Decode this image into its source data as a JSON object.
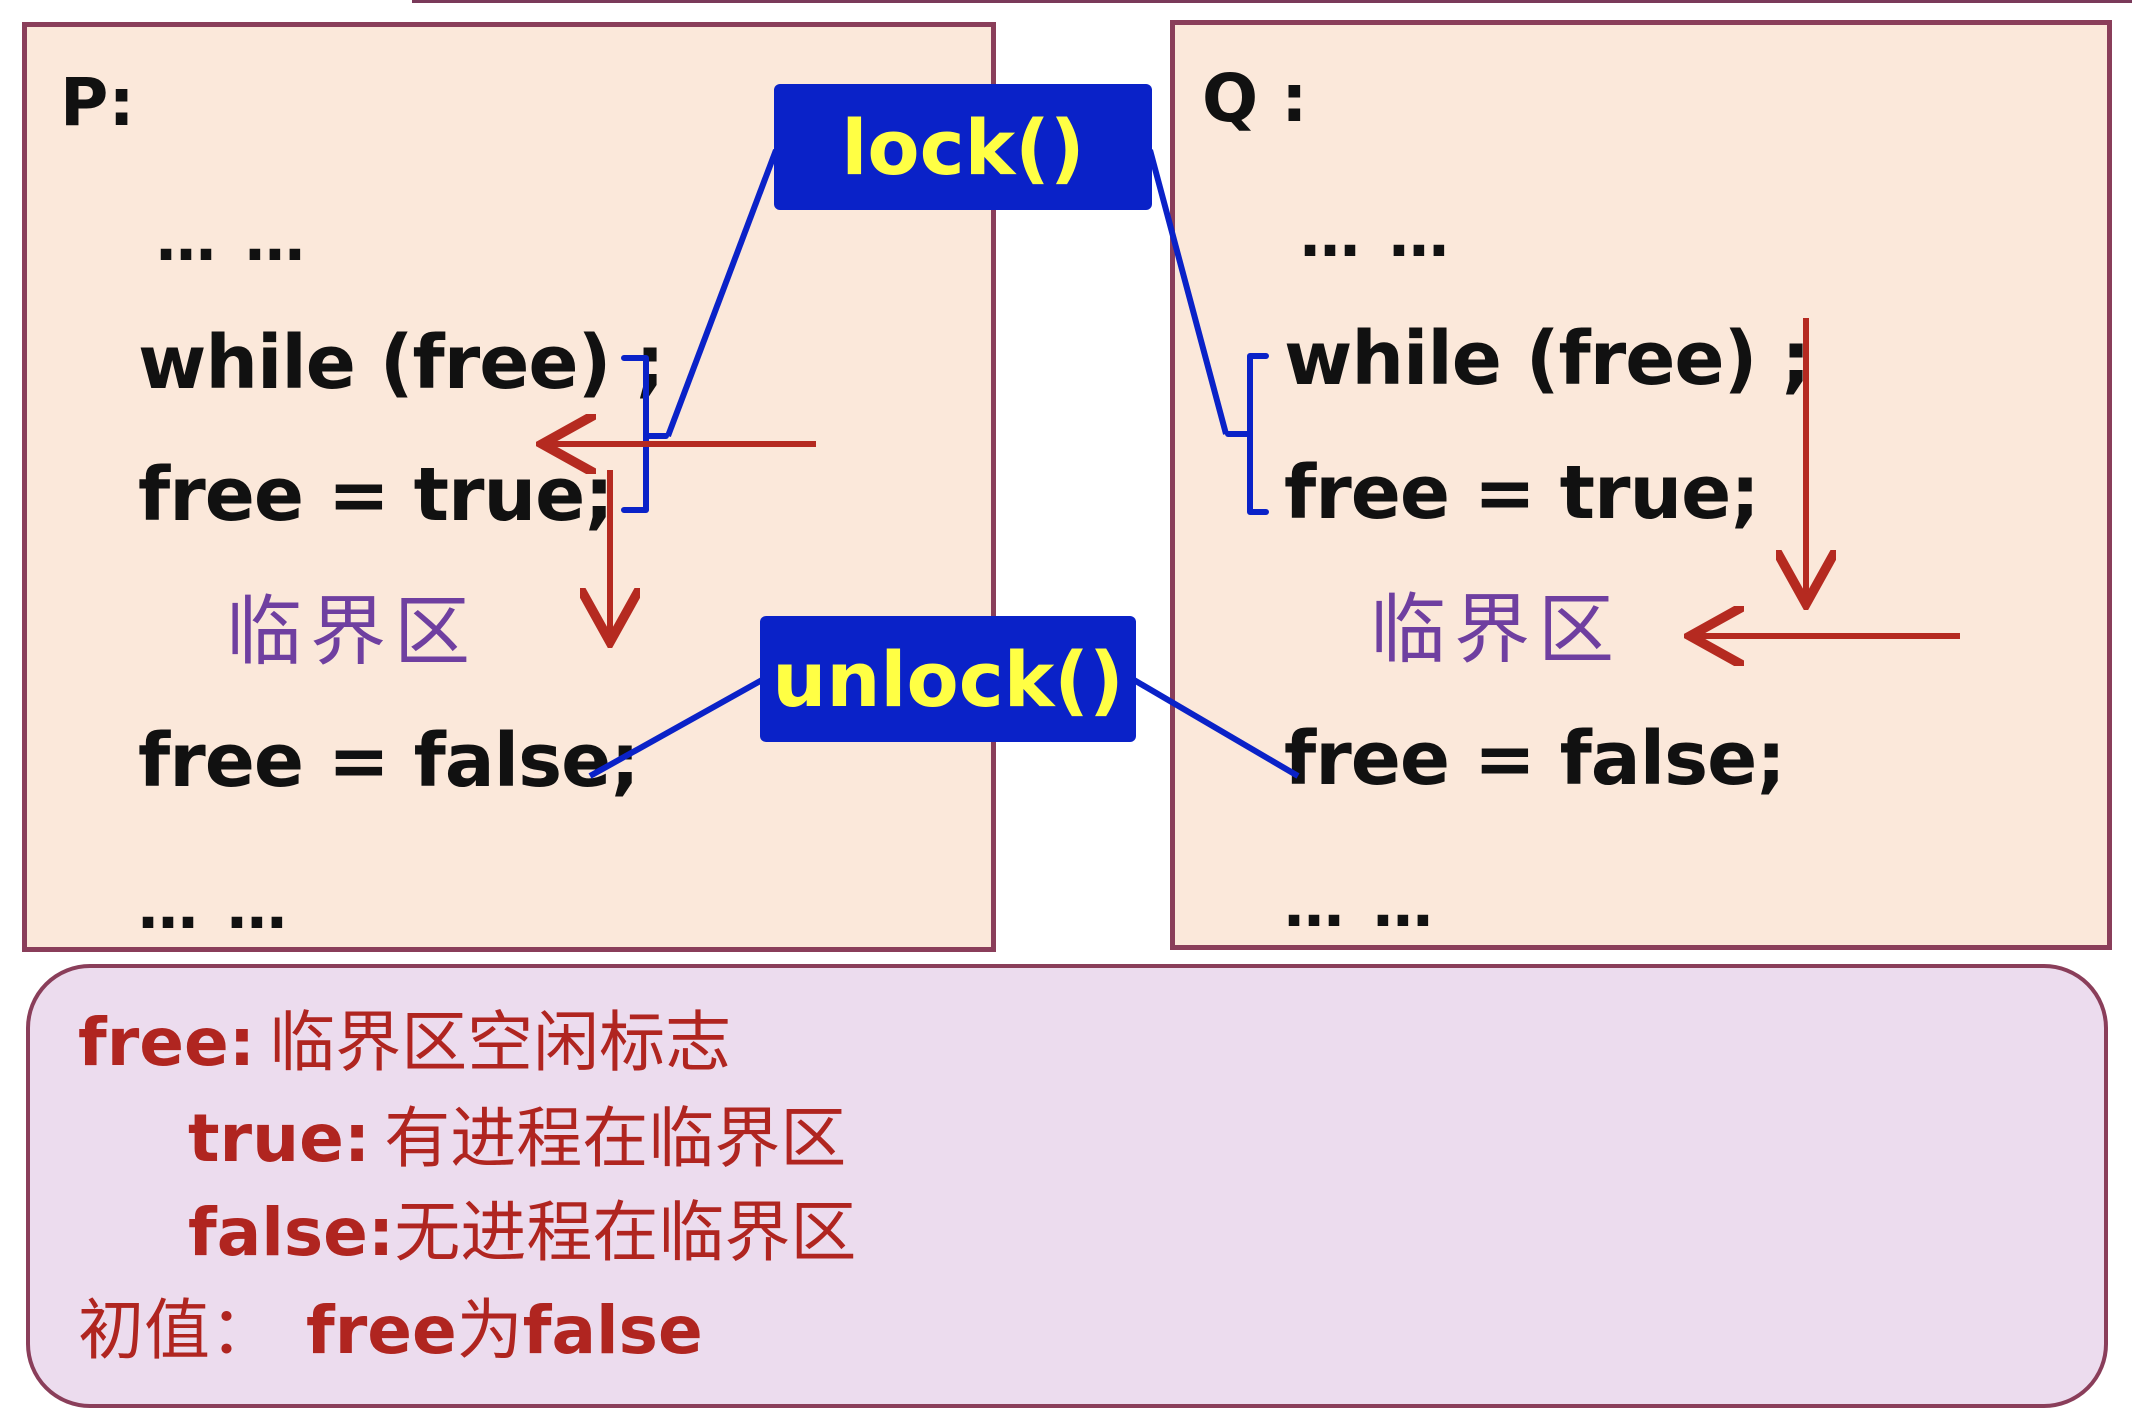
{
  "panel_p": {
    "label": "P:",
    "dots_top": "… …",
    "line_while": "while (free) ;",
    "line_set_true": "free = true;",
    "critical": "临界区",
    "line_set_false": "free = false;",
    "dots_bottom": "… …"
  },
  "panel_q": {
    "label": "Q :",
    "dots_top": "… …",
    "line_while": "while (free) ;",
    "line_set_true": "free = true;",
    "critical": "临界区",
    "line_set_false": "free = false;",
    "dots_bottom": "… …"
  },
  "callouts": {
    "lock": "lock()",
    "unlock": "unlock()"
  },
  "legend": {
    "line1_key": "free:",
    "line1_text": "临界区空闲标志",
    "line2_key": "true:",
    "line2_text": "有进程在临界区",
    "line3_key": "false:",
    "line3_text": "无进程在临界区",
    "line4_prefix": "初值：",
    "line4_var": "free",
    "line4_mid": "为",
    "line4_val": "false"
  },
  "colors": {
    "panel_bg": "#fbe8da",
    "panel_border": "#8a3e5a",
    "callout_bg": "#0a22c8",
    "callout_text": "#ffff44",
    "connector": "#0a22c8",
    "arrow": "#b52a20",
    "critical_text": "#6f3fa0",
    "legend_bg": "#ecdcee",
    "legend_text": "#b02520"
  }
}
